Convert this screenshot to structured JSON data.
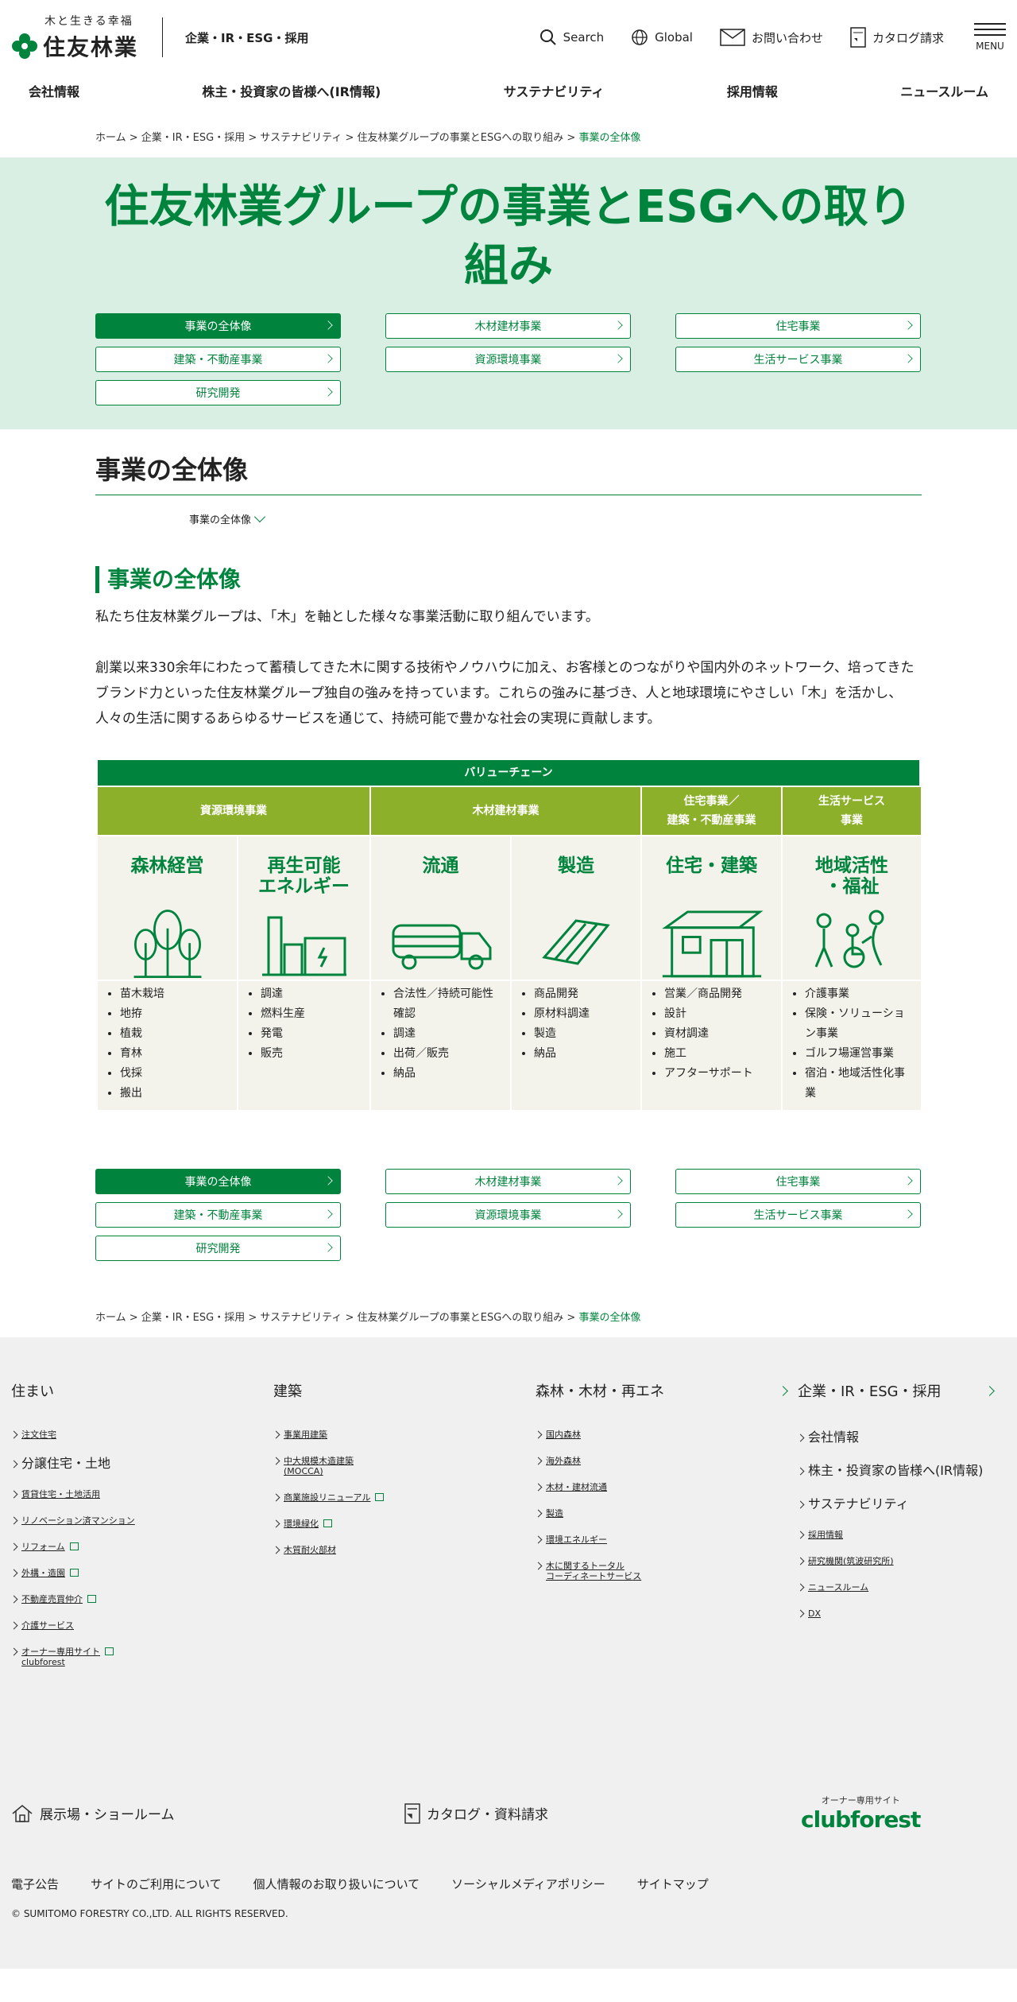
{
  "header": {
    "logo_tagline": "木と生きる幸福",
    "logo_name": "住友林業",
    "subtitle": "企業・IR・ESG・採用",
    "search": "Search",
    "global": "Global",
    "contact": "お問い合わせ",
    "catalog": "カタログ請求",
    "menu": "MENU"
  },
  "gnav": [
    "会社情報",
    "株主・投資家の皆様へ(IR情報)",
    "サステナビリティ",
    "採用情報",
    "ニュースルーム"
  ],
  "breadcrumb": {
    "items": [
      "ホーム",
      "企業・IR・ESG・採用",
      "サステナビリティ",
      "住友林業グループの事業とESGへの取り組み"
    ],
    "current": "事業の全体像"
  },
  "hero": {
    "title": "住友林業グループの事業とESGへの取り組み"
  },
  "tabs": [
    "事業の全体像",
    "木材建材事業",
    "住宅事業",
    "建築・不動産事業",
    "資源環境事業",
    "生活サービス事業",
    "研究開発"
  ],
  "section": {
    "title": "事業の全体像",
    "anchor": "事業の全体像",
    "h2": "事業の全体像",
    "p1": "私たち住友林業グループは、「木」を軸とした様々な事業活動に取り組んでいます。",
    "p2": "創業以来330余年にわたって蓄積してきた木に関する技術やノウハウに加え、お客様とのつながりや国内外のネットワーク、培ってきたブランド力といった住友林業グループ独自の強みを持っています。これらの強みに基づき、人と地球環境にやさしい「木」を活かし、人々の生活に関するあらゆるサービスを通じて、持続可能で豊かな社会の実現に貢献します。"
  },
  "value_chain": {
    "title": "バリューチェーン",
    "categories": [
      "資源環境事業",
      "木材建材事業",
      "住宅事業／\n建築・不動産事業",
      "生活サービス\n事業"
    ],
    "stages": [
      {
        "name": "森林経営",
        "icon": "tree-icon",
        "items": [
          "苗木栽培",
          "地拵",
          "植栽",
          "育林",
          "伐採",
          "搬出"
        ]
      },
      {
        "name": "再生可能\nエネルギー",
        "icon": "power-plant-icon",
        "items": [
          "調達",
          "燃料生産",
          "発電",
          "販売"
        ]
      },
      {
        "name": "流通",
        "icon": "truck-icon",
        "items": [
          "合法性／持続可能性確認",
          "調達",
          "出荷／販売",
          "納品"
        ]
      },
      {
        "name": "製造",
        "icon": "lumber-icon",
        "items": [
          "商品開発",
          "原材料調達",
          "製造",
          "納品"
        ]
      },
      {
        "name": "住宅・建築",
        "icon": "house-icon",
        "items": [
          "営業／商品開発",
          "設計",
          "資材調達",
          "施工",
          "アフターサポート"
        ]
      },
      {
        "name": "地域活性\n・福祉",
        "icon": "care-icon",
        "items": [
          "介護事業",
          "保険・ソリューション事業",
          "ゴルフ場運営事業",
          "宿泊・地域活性化事業"
        ]
      }
    ]
  },
  "footer": {
    "col1": {
      "head": "住まい",
      "links": [
        {
          "t": "注文住宅",
          "big": false,
          "ext": false
        },
        {
          "t": "分譲住宅・土地",
          "big": true,
          "ext": false
        },
        {
          "t": "賃貸住宅・土地活用",
          "big": false,
          "ext": false
        },
        {
          "t": "リノベーション済マンション",
          "big": false,
          "ext": false
        },
        {
          "t": "リフォーム",
          "big": false,
          "ext": true
        },
        {
          "t": "外構・造園",
          "big": false,
          "ext": true
        },
        {
          "t": "不動産売買仲介",
          "big": false,
          "ext": true
        },
        {
          "t": "介護サービス",
          "big": false,
          "ext": false
        },
        {
          "t": "オーナー専用サイト\nclubforest",
          "big": false,
          "ext": true
        }
      ]
    },
    "col2": {
      "head": "建築",
      "links": [
        {
          "t": "事業用建築",
          "big": false,
          "ext": false
        },
        {
          "t": "中大規模木造建築\n(MOCCA)",
          "big": false,
          "ext": false
        },
        {
          "t": "商業施設リニューアル",
          "big": false,
          "ext": true
        },
        {
          "t": "環境緑化",
          "big": false,
          "ext": true
        },
        {
          "t": "木質耐火部材",
          "big": false,
          "ext": false
        }
      ]
    },
    "col3": {
      "head": "森林・木材・再エネ",
      "links": [
        {
          "t": "国内森林",
          "big": false,
          "ext": false
        },
        {
          "t": "海外森林",
          "big": false,
          "ext": false
        },
        {
          "t": "木材・建材流通",
          "big": false,
          "ext": false
        },
        {
          "t": "製造",
          "big": false,
          "ext": false
        },
        {
          "t": "環境エネルギー",
          "big": false,
          "ext": false
        },
        {
          "t": "木に関するトータル\nコーディネートサービス",
          "big": false,
          "ext": false
        }
      ]
    },
    "col4": {
      "head": "企業・IR・ESG・採用",
      "links": [
        {
          "t": "会社情報",
          "big": true,
          "ext": false
        },
        {
          "t": "株主・投資家の皆様へ(IR情報)",
          "big": true,
          "ext": false
        },
        {
          "t": "サステナビリティ",
          "big": true,
          "ext": false
        },
        {
          "t": "採用情報",
          "big": false,
          "ext": false
        },
        {
          "t": "研究機関(筑波研究所)",
          "big": false,
          "ext": false
        },
        {
          "t": "ニュースルーム",
          "big": false,
          "ext": false
        },
        {
          "t": "DX",
          "big": false,
          "ext": false
        }
      ]
    },
    "showroom": "展示場・ショールーム",
    "catalog": "カタログ・資料請求",
    "club_small": "オーナー専用サイト",
    "club_logo": "clubforest",
    "bottom_links": [
      "電子公告",
      "サイトのご利用について",
      "個人情報のお取り扱いについて",
      "ソーシャルメディアポリシー",
      "サイトマップ"
    ],
    "copyright": "© SUMITOMO FORESTRY CO.,LTD. ALL RIGHTS RESERVED."
  },
  "colors": {
    "brand_green": "#00843d",
    "value_chain_green": "#8db02b",
    "hero_bg": "#d9efe4"
  }
}
